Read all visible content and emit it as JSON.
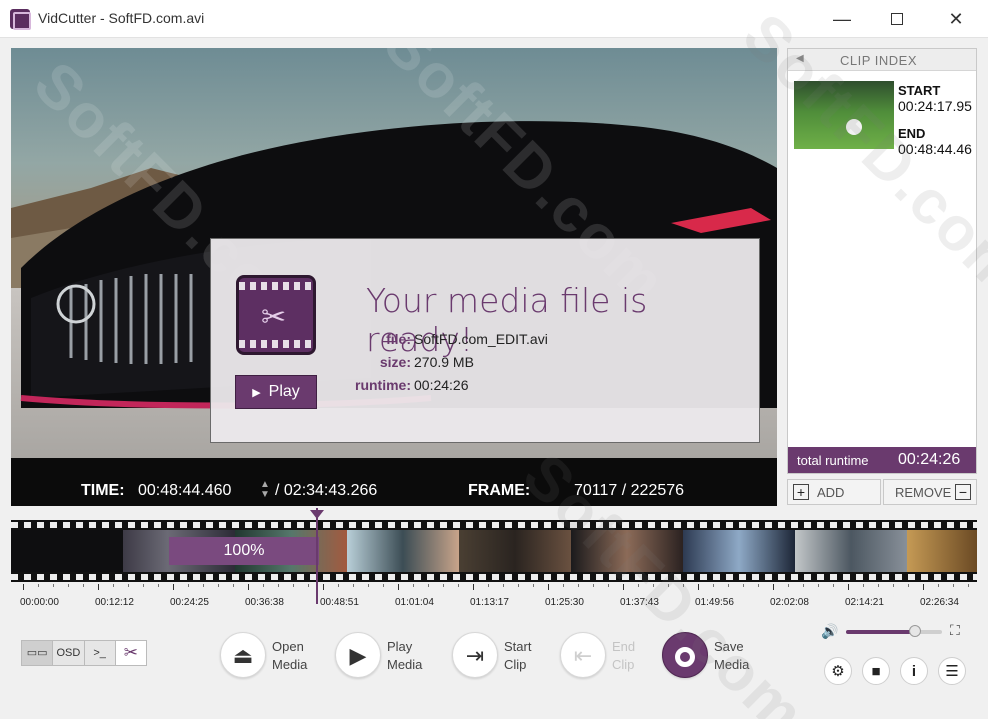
{
  "window": {
    "title": "VidCutter - SoftFD.com.avi",
    "minimize_glyph": "—",
    "close_glyph": "✕"
  },
  "player": {
    "time_label": "TIME:",
    "time_value": "00:48:44.460",
    "duration": "/ 02:34:43.266",
    "frame_label": "FRAME:",
    "frame_value": "70117  / 222576"
  },
  "dialog": {
    "title": "Your media file is ready!",
    "file_label": "file:",
    "file_value": "SoftFD.com_EDIT.avi",
    "size_label": "size:",
    "size_value": "270.9 MB",
    "runtime_label": "runtime:",
    "runtime_value": "00:24:26",
    "play_label": "Play",
    "play_icon": "play-triangle"
  },
  "clip_index": {
    "header": "CLIP INDEX",
    "clips": [
      {
        "start_label": "START",
        "start": "00:24:17.95",
        "end_label": "END",
        "end": "00:48:44.46"
      }
    ],
    "total_label": "total runtime",
    "total_value": "00:24:26",
    "add_label": "ADD",
    "remove_label": "REMOVE"
  },
  "timeline": {
    "progress_label": "100%",
    "progress_fraction": 1.0,
    "ticks": [
      "00:00:00",
      "00:12:12",
      "00:24:25",
      "00:36:38",
      "00:48:51",
      "01:01:04",
      "01:13:17",
      "01:25:30",
      "01:37:43",
      "01:49:56",
      "02:02:08",
      "02:14:21",
      "02:26:34"
    ]
  },
  "toolbar": {
    "osd_label": "OSD",
    "console_label": ">_",
    "open": "Open\nMedia",
    "play": "Play\nMedia",
    "start": "Start\nClip",
    "end": "End\nClip",
    "save": "Save\nMedia",
    "volume_level": 0.72
  },
  "watermark": "SoftFD.com",
  "colors": {
    "accent": "#6a3a6e",
    "video_bg": "#0b0b0b"
  }
}
